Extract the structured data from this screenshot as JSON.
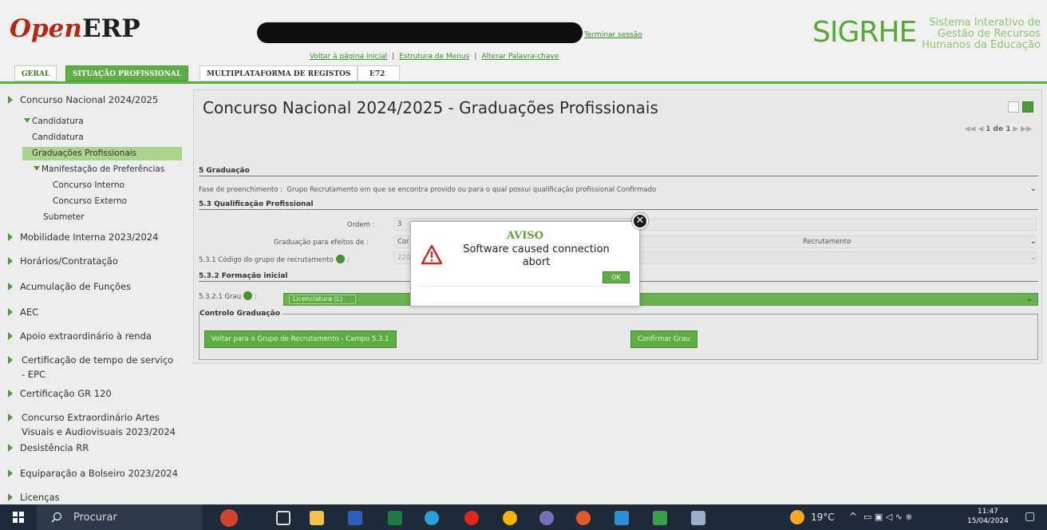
{
  "header": {
    "logo_open": "Open",
    "logo_erp": "ERP",
    "logout_label": "Terminar sessão",
    "links": [
      "Voltar à página inicial",
      "Estrutura de Menus",
      "Alterar Palavra-chave"
    ],
    "brand": "SIGRHE",
    "brand_sub": [
      "Sistema Interativo de",
      "Gestão de Recursos",
      "Humanos da Educação"
    ],
    "tabs": [
      "GERAL",
      "SITUAÇÃO PROFISSIONAL",
      "MULTIPLATAFORMA DE REGISTOS",
      "E72"
    ],
    "colors": {
      "accent_green": "#5fad45",
      "logo_red": "#b22a16"
    }
  },
  "sidebar": {
    "items": [
      "Concurso Nacional 2024/2025",
      "Candidatura",
      "Candidatura",
      "Graduações Profissionais",
      "Manifestação de Preferências",
      "Concurso Interno",
      "Concurso Externo",
      "Submeter",
      "Mobilidade Interna 2023/2024",
      "Horários/Contratação",
      "Acumulação de Funções",
      "AEC",
      "Apoio extraordinário à renda",
      "Certificação de tempo de serviço - EPC",
      "Certificação GR 120",
      "Concurso Extraordinário Artes Visuais e Audiovisuais 2023/2024",
      "Desistência RR",
      "Equiparação a Bolseiro 2023/2024",
      "Licenças"
    ]
  },
  "main": {
    "title": "Concurso Nacional 2024/2025 - Graduações Profissionais",
    "pager": {
      "label": "1 de 1"
    },
    "sec5": "5 Graduação",
    "fase_label": "Fase de preenchimento :",
    "fase_value": "Grupo Recrutamento em que se encontra provido ou para o qual possui qualificação profissional Confirmado",
    "sec53": "5.3 Qualificação Profissional",
    "ordem_label": "Ordem :",
    "ordem_value": "3",
    "grad_label": "Graduação para efeitos de :",
    "grad_value_left": "Cor",
    "grad_value_right": "Recrutamento",
    "codigo_label": "5.3.1 Código do grupo de recrutamento",
    "codigo_value": "220",
    "sec532": "5.3.2 Formação inicial",
    "grau_label": "5.3.2.1 Grau",
    "grau_value": "Licenciatura (L)",
    "controlo_legend": "Controlo Graduação",
    "btn_voltar": "Voltar para o Grupo de Recrutamento - Campo 5.3.1",
    "btn_confirmar": "Confirmar Grau"
  },
  "dialog": {
    "title": "AVISO",
    "message": "Software caused connection abort",
    "ok_label": "OK"
  },
  "taskbar": {
    "search_placeholder": "Procurar",
    "weather": "19°C",
    "time": "11:47",
    "date": "15/04/2024"
  }
}
